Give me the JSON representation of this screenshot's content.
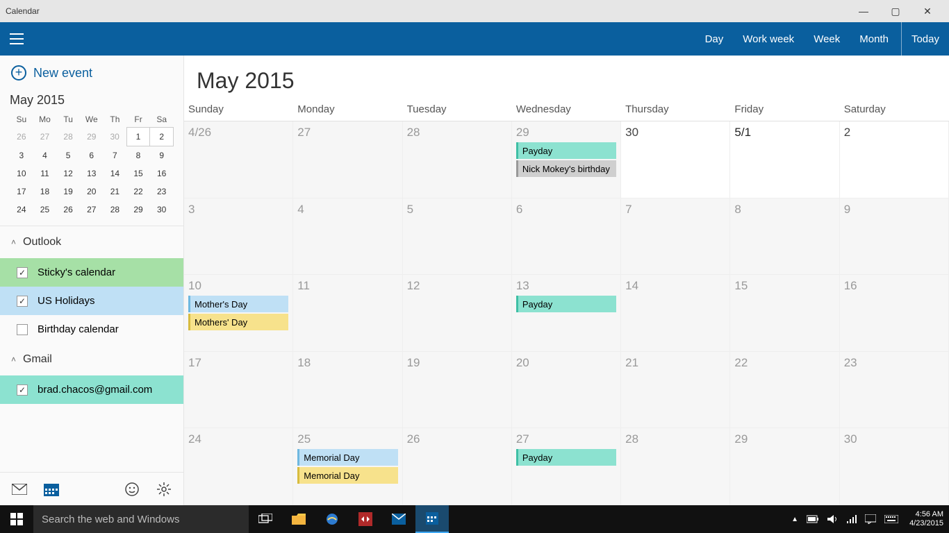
{
  "titlebar": {
    "title": "Calendar"
  },
  "topnav": {
    "views": [
      "Day",
      "Work week",
      "Week",
      "Month"
    ],
    "today": "Today"
  },
  "newevent": {
    "label": "New event"
  },
  "minical": {
    "title": "May 2015",
    "dow": [
      "Su",
      "Mo",
      "Tu",
      "We",
      "Th",
      "Fr",
      "Sa"
    ],
    "rows": [
      [
        {
          "n": "26",
          "o": true
        },
        {
          "n": "27",
          "o": true
        },
        {
          "n": "28",
          "o": true
        },
        {
          "n": "29",
          "o": true
        },
        {
          "n": "30",
          "o": true
        },
        {
          "n": "1",
          "sel": true
        },
        {
          "n": "2",
          "sel": true
        }
      ],
      [
        {
          "n": "3"
        },
        {
          "n": "4"
        },
        {
          "n": "5"
        },
        {
          "n": "6"
        },
        {
          "n": "7"
        },
        {
          "n": "8"
        },
        {
          "n": "9"
        }
      ],
      [
        {
          "n": "10"
        },
        {
          "n": "11"
        },
        {
          "n": "12"
        },
        {
          "n": "13"
        },
        {
          "n": "14"
        },
        {
          "n": "15"
        },
        {
          "n": "16"
        }
      ],
      [
        {
          "n": "17"
        },
        {
          "n": "18"
        },
        {
          "n": "19"
        },
        {
          "n": "20"
        },
        {
          "n": "21"
        },
        {
          "n": "22"
        },
        {
          "n": "23"
        }
      ],
      [
        {
          "n": "24"
        },
        {
          "n": "25"
        },
        {
          "n": "26"
        },
        {
          "n": "27"
        },
        {
          "n": "28"
        },
        {
          "n": "29"
        },
        {
          "n": "30"
        }
      ]
    ]
  },
  "sources": {
    "outlook": {
      "label": "Outlook",
      "items": [
        {
          "label": "Sticky's calendar",
          "checked": true,
          "cls": "sticky"
        },
        {
          "label": "US Holidays",
          "checked": true,
          "cls": "usholidays"
        },
        {
          "label": "Birthday calendar",
          "checked": false,
          "cls": ""
        }
      ]
    },
    "gmail": {
      "label": "Gmail",
      "items": [
        {
          "label": "brad.chacos@gmail.com",
          "checked": true,
          "cls": "gmail"
        }
      ]
    }
  },
  "month": {
    "title": "May 2015",
    "dow": [
      "Sunday",
      "Monday",
      "Tuesday",
      "Wednesday",
      "Thursday",
      "Friday",
      "Saturday"
    ],
    "weeks": [
      [
        {
          "n": "4/26",
          "o": true,
          "ev": []
        },
        {
          "n": "27",
          "o": true,
          "ev": []
        },
        {
          "n": "28",
          "o": true,
          "ev": []
        },
        {
          "n": "29",
          "o": true,
          "ev": [
            {
              "t": "Payday",
              "c": "teal"
            },
            {
              "t": "Nick Mokey's birthday",
              "c": "gray"
            }
          ]
        },
        {
          "n": "30",
          "o": false,
          "ev": []
        },
        {
          "n": "5/1",
          "o": false,
          "first": true,
          "ev": []
        },
        {
          "n": "2",
          "o": false,
          "ev": []
        }
      ],
      [
        {
          "n": "3",
          "o": true,
          "ev": []
        },
        {
          "n": "4",
          "o": true,
          "ev": []
        },
        {
          "n": "5",
          "o": true,
          "ev": []
        },
        {
          "n": "6",
          "o": true,
          "ev": []
        },
        {
          "n": "7",
          "o": true,
          "ev": []
        },
        {
          "n": "8",
          "o": true,
          "ev": []
        },
        {
          "n": "9",
          "o": true,
          "ev": []
        }
      ],
      [
        {
          "n": "10",
          "o": true,
          "ev": [
            {
              "t": "Mother's Day",
              "c": "blue"
            },
            {
              "t": "Mothers' Day",
              "c": "yellow"
            }
          ]
        },
        {
          "n": "11",
          "o": true,
          "ev": []
        },
        {
          "n": "12",
          "o": true,
          "ev": []
        },
        {
          "n": "13",
          "o": true,
          "ev": [
            {
              "t": "Payday",
              "c": "teal"
            }
          ]
        },
        {
          "n": "14",
          "o": true,
          "ev": []
        },
        {
          "n": "15",
          "o": true,
          "ev": []
        },
        {
          "n": "16",
          "o": true,
          "ev": []
        }
      ],
      [
        {
          "n": "17",
          "o": true,
          "ev": []
        },
        {
          "n": "18",
          "o": true,
          "ev": []
        },
        {
          "n": "19",
          "o": true,
          "ev": []
        },
        {
          "n": "20",
          "o": true,
          "ev": []
        },
        {
          "n": "21",
          "o": true,
          "ev": []
        },
        {
          "n": "22",
          "o": true,
          "ev": []
        },
        {
          "n": "23",
          "o": true,
          "ev": []
        }
      ],
      [
        {
          "n": "24",
          "o": true,
          "ev": []
        },
        {
          "n": "25",
          "o": true,
          "ev": [
            {
              "t": "Memorial Day",
              "c": "blue"
            },
            {
              "t": "Memorial Day",
              "c": "yellow"
            }
          ]
        },
        {
          "n": "26",
          "o": true,
          "ev": []
        },
        {
          "n": "27",
          "o": true,
          "ev": [
            {
              "t": "Payday",
              "c": "teal"
            }
          ]
        },
        {
          "n": "28",
          "o": true,
          "ev": []
        },
        {
          "n": "29",
          "o": true,
          "ev": []
        },
        {
          "n": "30",
          "o": true,
          "ev": []
        }
      ]
    ]
  },
  "taskbar": {
    "search_placeholder": "Search the web and Windows",
    "time": "4:56 AM",
    "date": "4/23/2015"
  }
}
